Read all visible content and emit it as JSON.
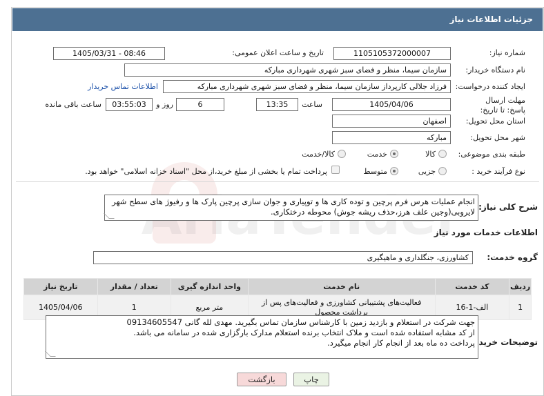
{
  "header": {
    "title": "جزئیات اطلاعات نیاز"
  },
  "fields": {
    "need_number_label": "شماره نیاز:",
    "need_number": "1105105372000007",
    "announce_label": "تاریخ و ساعت اعلان عمومی:",
    "announce_value": "1405/03/31 - 08:46",
    "buyer_org_label": "نام دستگاه خریدار:",
    "buyer_org": "سازمان سیما، منظر و فضای سبز شهری شهرداری مبارکه",
    "creator_label": "ایجاد کننده درخواست:",
    "creator": "فرزاد جلالی کارپرداز سازمان سیما، منظر و فضای سبز شهری شهرداری مبارکه",
    "buyer_contact_link": "اطلاعات تماس خریدار",
    "deadline_label": "مهلت ارسال پاسخ: تا تاریخ:",
    "deadline_date": "1405/04/06",
    "time_label": "ساعت",
    "deadline_time": "13:35",
    "days_value": "6",
    "days_label": "روز و",
    "remaining_value": "03:55:03",
    "remaining_label": "ساعت باقی مانده",
    "province_label": "استان محل تحویل:",
    "province": "اصفهان",
    "city_label": "شهر محل تحویل:",
    "city": "مبارکه",
    "category_label": "طبقه بندی موضوعی:",
    "category_options": [
      "کالا",
      "خدمت",
      "کالا/خدمت"
    ],
    "category_selected": "خدمت",
    "process_label": "نوع فرآیند خرید :",
    "process_options": [
      "جزیی",
      "متوسط"
    ],
    "process_selected": "متوسط",
    "payment_note": "پرداخت تمام یا بخشی از مبلغ خرید،از محل \"اسناد خزانه اسلامی\" خواهد بود."
  },
  "summary": {
    "label": "شرح کلی نیاز:",
    "text": "انجام عملیات هرس فرم پرچین و توده کاری ها و توپیاری و جوان سازی پرچین پارک ها و رفیوژ های سطح شهر لایروبی(وجین علف هرز،حذف ریشه جوش) محوطه درختکاری."
  },
  "services": {
    "section_title": "اطلاعات خدمات مورد نیاز",
    "group_label": "گروه خدمت:",
    "group_value": "کشاورزی، جنگلداری و ماهیگیری",
    "columns": [
      "ردیف",
      "کد خدمت",
      "نام خدمت",
      "واحد اندازه گیری",
      "تعداد / مقدار",
      "تاریخ نیاز"
    ],
    "rows": [
      [
        "1",
        "الف-1-16",
        "فعالیت‌های پشتیبانی کشاورزی و فعالیت‌های پس از برداشت محصول",
        "متر مربع",
        "1",
        "1405/04/06"
      ]
    ]
  },
  "buyer_notes": {
    "label": "توضیحات خریدار:",
    "lines": [
      "جهت شرکت در استعلام و بازدید زمین با کارشناس سازمان تماس بگیرید. مهدی لله گانی 09134605547",
      "از کد مشابه استفاده شده است و ملاک انتخاب برنده استعلام مدارک بارگزاری شده در سامانه می باشد.",
      "پرداخت ده ماه بعد از انجام کار انجام میگیرد."
    ]
  },
  "buttons": {
    "print": "چاپ",
    "back": "بازگشت"
  },
  "colors": {
    "header_bg": "#4d7092",
    "back_bg": "#f7d9d9",
    "print_bg": "#eaf3e4",
    "link": "#1a4fa8"
  }
}
